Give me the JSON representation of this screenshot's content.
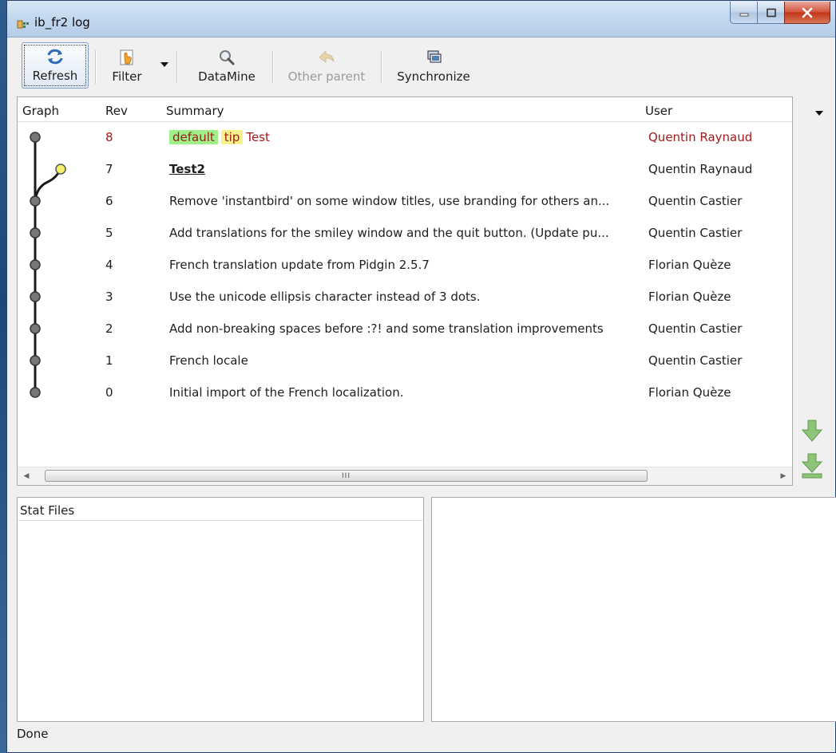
{
  "window": {
    "title": "ib_fr2 log"
  },
  "toolbar": {
    "refresh": "Refresh",
    "filter": "Filter",
    "datamine": "DataMine",
    "other_parent": "Other parent",
    "synchronize": "Synchronize"
  },
  "log": {
    "columns": {
      "graph": "Graph",
      "rev": "Rev",
      "summary": "Summary",
      "user": "User"
    },
    "rows": [
      {
        "rev": "8",
        "tags": [
          "default",
          "tip"
        ],
        "summary": "Test",
        "user": "Quentin Raynaud"
      },
      {
        "rev": "7",
        "tags": [],
        "summary": "Test2",
        "user": "Quentin Raynaud"
      },
      {
        "rev": "6",
        "tags": [],
        "summary": "Remove 'instantbird' on some window titles, use branding for others an...",
        "user": "Quentin Castier"
      },
      {
        "rev": "5",
        "tags": [],
        "summary": "Add translations for the smiley window and the quit button. (Update pu...",
        "user": "Quentin Castier"
      },
      {
        "rev": "4",
        "tags": [],
        "summary": "French translation update from Pidgin 2.5.7",
        "user": "Florian Quèze"
      },
      {
        "rev": "3",
        "tags": [],
        "summary": "Use the unicode ellipsis character instead of 3 dots.",
        "user": "Florian Quèze"
      },
      {
        "rev": "2",
        "tags": [],
        "summary": "Add non-breaking spaces before :?! and some translation improvements",
        "user": "Quentin Castier"
      },
      {
        "rev": "1",
        "tags": [],
        "summary": "French locale",
        "user": "Quentin Castier"
      },
      {
        "rev": "0",
        "tags": [],
        "summary": "Initial import of the French localization.",
        "user": "Florian Quèze"
      }
    ],
    "scroll_thumb_grip": "III"
  },
  "stat_files": {
    "header": "Stat Files"
  },
  "status": {
    "text": "Done"
  },
  "colors": {
    "working_dir_red": "#a31a1a",
    "tag_default": "#9ef08a",
    "tag_tip": "#f5f28a"
  }
}
